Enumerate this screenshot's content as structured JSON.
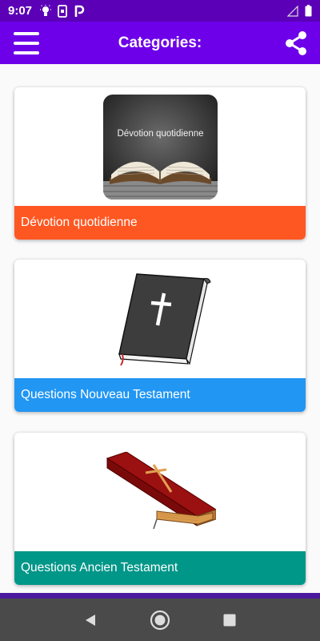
{
  "status_bar": {
    "time": "9:07",
    "icons_left": [
      "lightbulb-icon",
      "phone-screen-icon",
      "parking-icon"
    ],
    "icons_right": [
      "signal-icon",
      "battery-icon"
    ],
    "background": "#5b00b6"
  },
  "app_bar": {
    "title": "Categories:",
    "menu_icon": "hamburger-menu-icon",
    "share_icon": "share-icon",
    "background": "#6d00e8"
  },
  "categories": [
    {
      "label": "Dévotion quotidienne",
      "image_caption": "Dévotion quotidienne",
      "image": "open-bible-image",
      "color": "#ff5722"
    },
    {
      "label": "Questions Nouveau Testament",
      "image": "black-bible-image",
      "color": "#2196f3"
    },
    {
      "label": "Questions Ancien Testament",
      "image": "red-bible-image",
      "color": "#009688"
    }
  ],
  "nav_bar": {
    "buttons": [
      "back-icon",
      "home-icon",
      "recents-icon"
    ],
    "background": "#4a4a4a"
  }
}
